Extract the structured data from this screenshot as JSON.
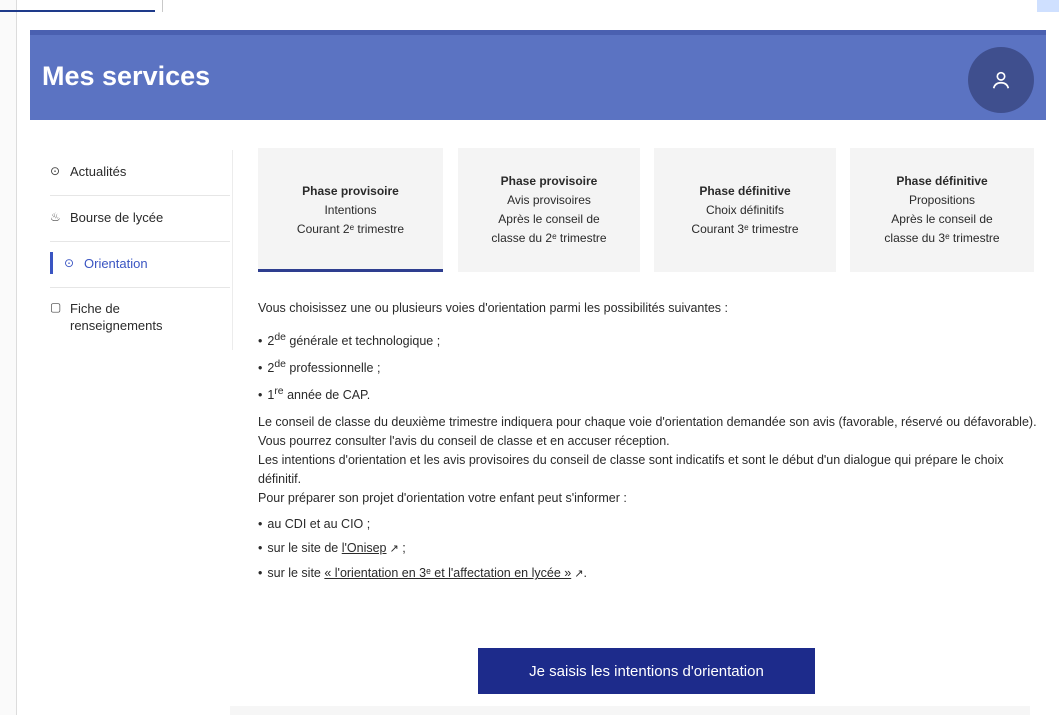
{
  "header": {
    "title": "Mes services"
  },
  "sidebar": {
    "items": [
      {
        "label": "Actualités"
      },
      {
        "label": "Bourse de lycée"
      },
      {
        "label": "Orientation"
      },
      {
        "label": "Fiche de renseignements"
      }
    ]
  },
  "tabs": [
    {
      "head": "Phase provisoire",
      "line2": "Intentions",
      "line3": "Courant 2ᵉ trimestre"
    },
    {
      "head": "Phase provisoire",
      "line2": "Avis provisoires",
      "line3": "Après le conseil de",
      "line4": "classe du 2ᵉ trimestre"
    },
    {
      "head": "Phase définitive",
      "line2": "Choix définitifs",
      "line3": "Courant 3ᵉ trimestre"
    },
    {
      "head": "Phase définitive",
      "line2": "Propositions",
      "line3": "Après le conseil de",
      "line4": "classe du 3ᵉ trimestre"
    }
  ],
  "content": {
    "intro": "Vous choisissez une ou plusieurs voies d'orientation parmi les possibilités suivantes :",
    "options": [
      {
        "sup": "de",
        "pre": "2",
        "text": " générale et technologique ;"
      },
      {
        "sup": "de",
        "pre": "2",
        "text": " professionnelle ;"
      },
      {
        "sup": "re",
        "pre": "1",
        "text": " année de CAP."
      }
    ],
    "para1": "Le conseil de classe du deuxième trimestre indiquera pour chaque voie d'orientation demandée son avis (favorable, réservé ou défavorable).",
    "para2": "Vous pourrez consulter l'avis du conseil de classe et en accuser réception.",
    "para3": "Les intentions d'orientation et les avis provisoires du conseil de classe sont indicatifs et sont le début d'un dialogue qui prépare le choix définitif.",
    "para4": "Pour préparer son projet d'orientation votre enfant peut s'informer :",
    "info1": "au CDI et au CIO ;",
    "info2_pre": "sur le site de ",
    "info2_link": "l'Onisep",
    "info2_post": " ;",
    "info3_pre": "sur le site ",
    "info3_link": "« l'orientation en 3ᵉ et l'affectation en lycée »",
    "info3_post": "."
  },
  "cta": {
    "label": "Je saisis les intentions d'orientation"
  },
  "colors": {
    "header": "#5b73c2",
    "accent": "#3a55c2",
    "cta": "#1d2b8b"
  },
  "icons": [
    "clock-icon",
    "purse-icon",
    "compass-icon",
    "document-icon",
    "user-icon",
    "external-link-icon"
  ]
}
